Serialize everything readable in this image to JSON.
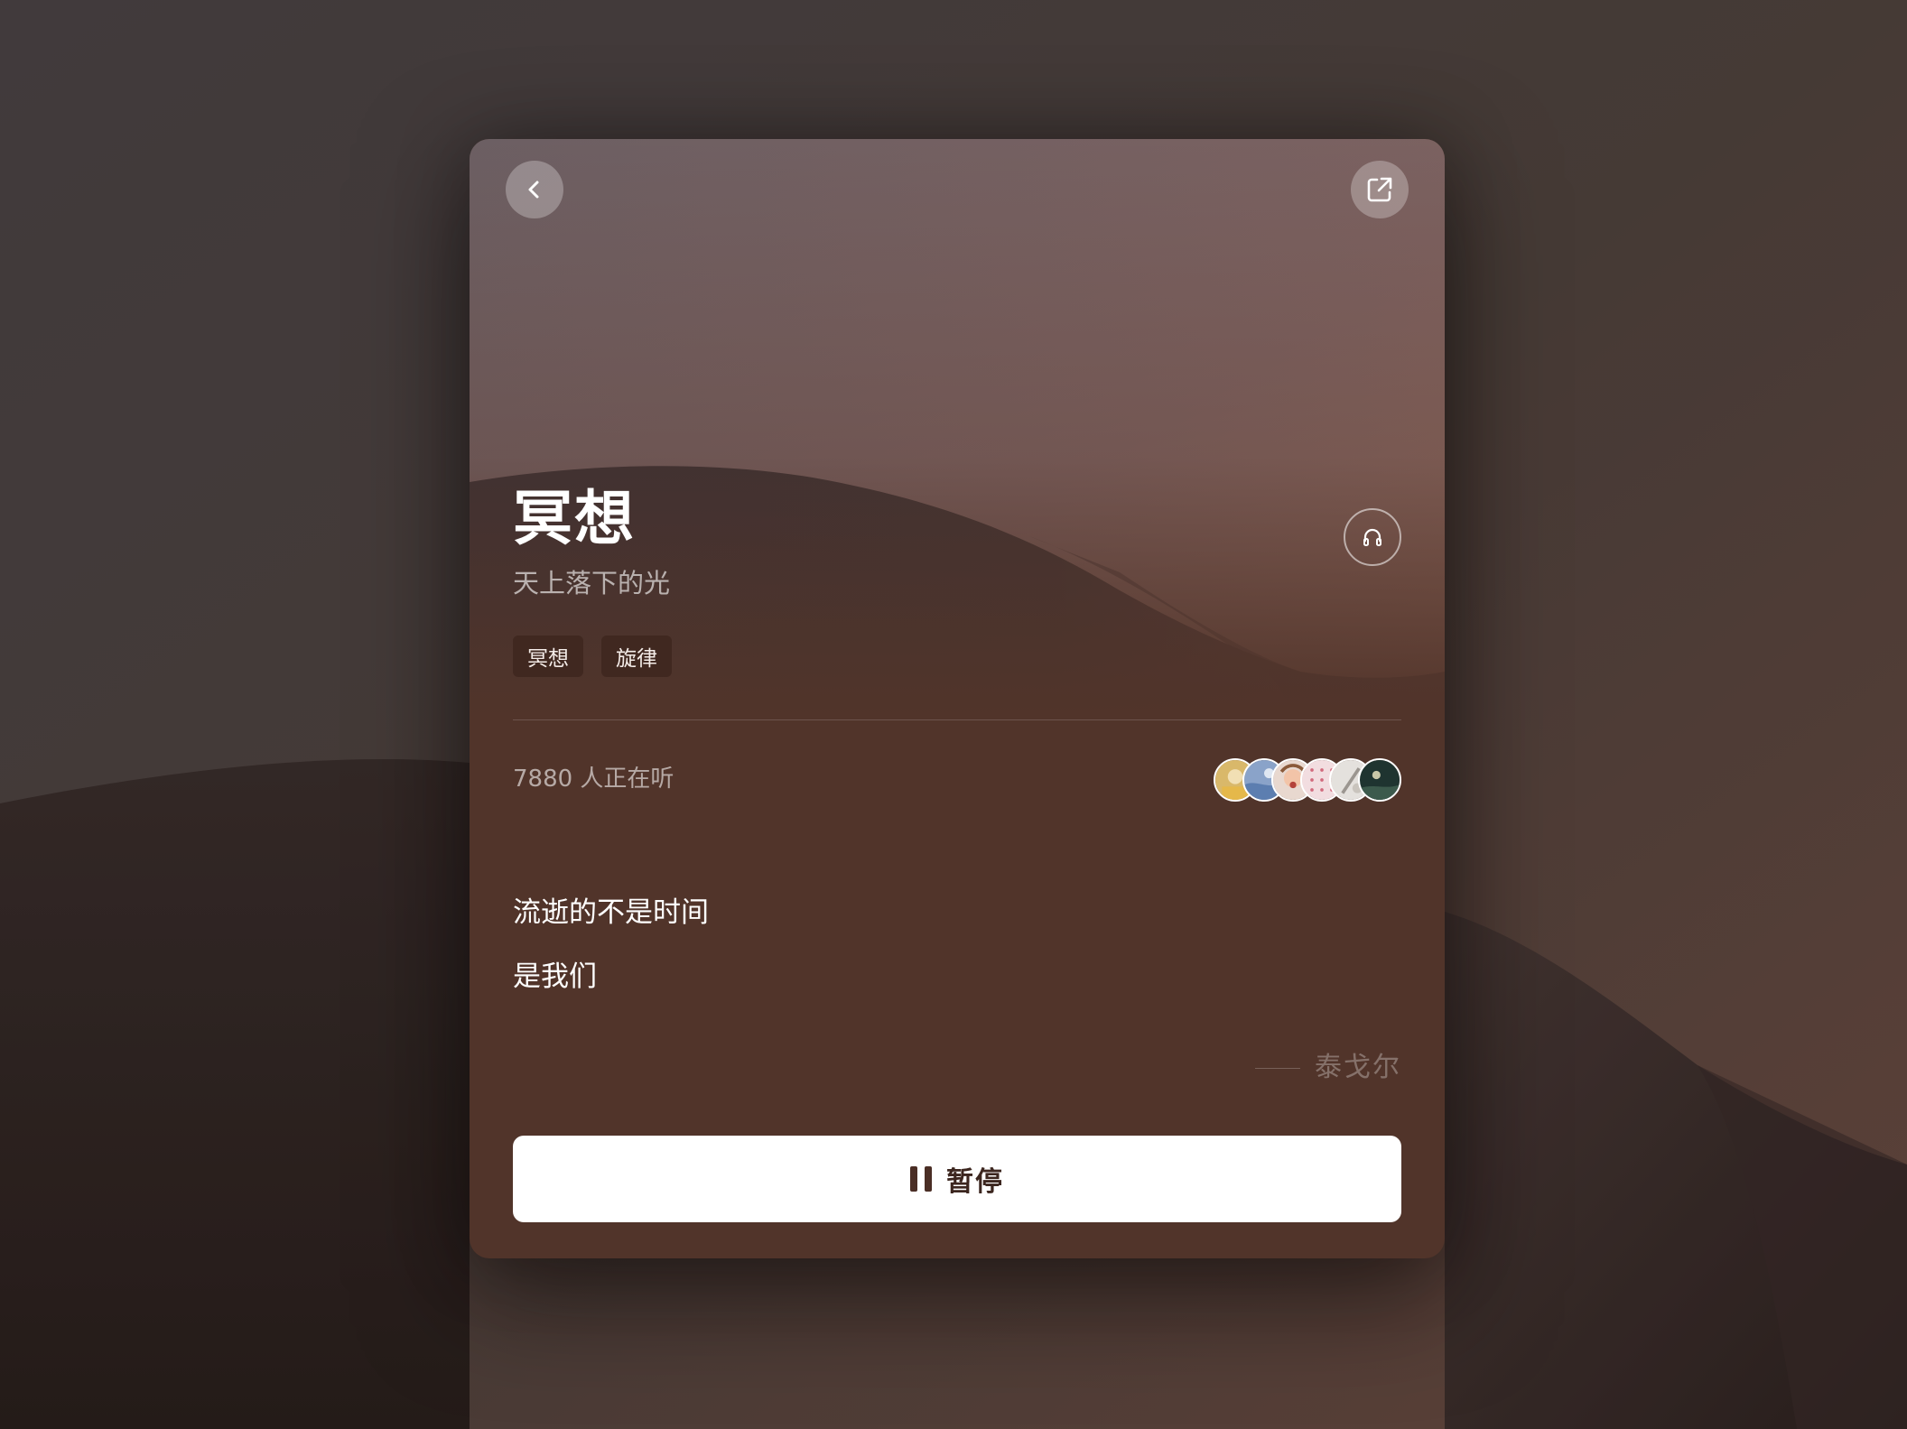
{
  "background": {
    "icon": "desert-dunes-scene"
  },
  "card": {
    "back_button": {
      "icon": "chevron-left-icon"
    },
    "share_button": {
      "icon": "share-external-icon"
    },
    "listen_button": {
      "icon": "headphones-icon"
    },
    "title": "冥想",
    "subtitle": "天上落下的光",
    "tags": [
      {
        "label": "冥想"
      },
      {
        "label": "旋律"
      }
    ],
    "listeners": {
      "text": "7880 人正在听",
      "avatars": [
        {
          "icon": "avatar-1"
        },
        {
          "icon": "avatar-2"
        },
        {
          "icon": "avatar-3"
        },
        {
          "icon": "avatar-4"
        },
        {
          "icon": "avatar-5"
        },
        {
          "icon": "avatar-6"
        }
      ]
    },
    "quote": {
      "lines": [
        "流逝的不是时间",
        "是我们"
      ],
      "author": "泰戈尔"
    },
    "pause_button": {
      "icon": "pause-icon",
      "label": "暂停"
    }
  },
  "colors": {
    "card_bottom": "#51342a",
    "button_bg": "#ffffff",
    "button_text": "#3c261f"
  }
}
